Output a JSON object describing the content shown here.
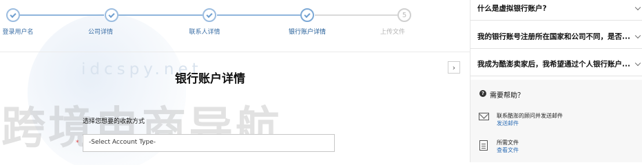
{
  "steps": [
    {
      "label": "登录用户名",
      "status": "completed",
      "number": ""
    },
    {
      "label": "公司详情",
      "status": "completed",
      "number": ""
    },
    {
      "label": "联系人详情",
      "status": "completed",
      "number": ""
    },
    {
      "label": "银行账户详情",
      "status": "current",
      "number": ""
    },
    {
      "label": "上传文件",
      "status": "pending",
      "number": "5"
    }
  ],
  "watermark": {
    "url": "idcspy.net",
    "text": "跨境电商导航"
  },
  "main": {
    "title": "银行账户详情",
    "next_icon": "chevron-right-icon",
    "field_label": "选择您想要的收款方式",
    "required_mark": "*",
    "select_value": "-Select Account Type-"
  },
  "sidebar": {
    "faq": [
      "什么是虚拟银行账户?",
      "我的银行账号注册所在国家和公司不同，是否...",
      "我成为酷澎卖家后，我希望通过个人银行账户..."
    ],
    "help": {
      "title": "需要帮助？",
      "contact_text": "联系酷澎的顾问并发送邮件",
      "contact_link": "发送邮件",
      "docs_text": "所需文件",
      "docs_link": "查看文件"
    }
  },
  "colors": {
    "accent": "#2f6fb6",
    "step_line": "#8fb5dc",
    "required": "#e03c3c"
  }
}
